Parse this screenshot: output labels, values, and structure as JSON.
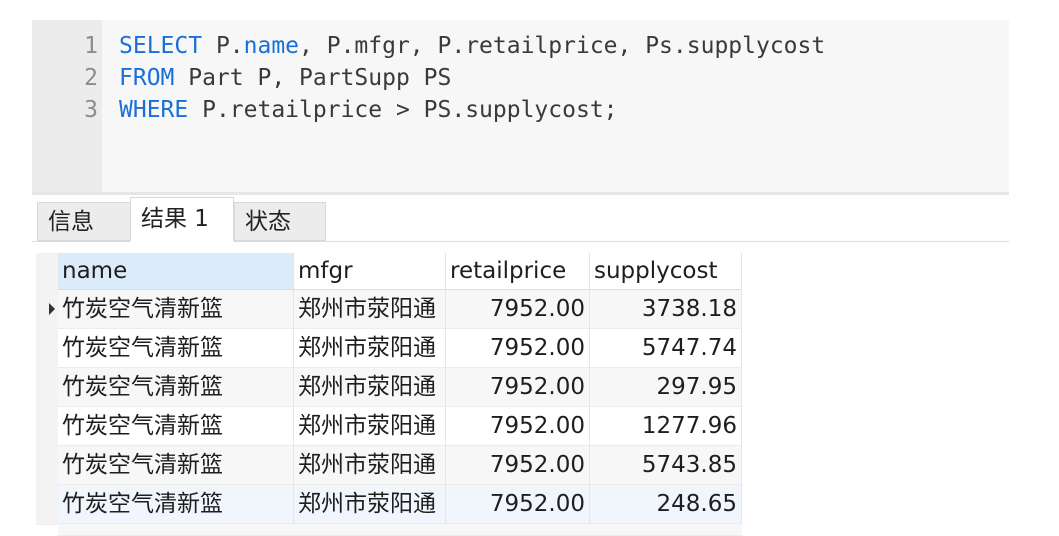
{
  "editor": {
    "lines": [
      {
        "num": "1",
        "parts": [
          {
            "t": "SELECT",
            "k": true
          },
          {
            "t": " P.",
            "k": false
          },
          {
            "t": "name",
            "k": true
          },
          {
            "t": ", P.mfgr, P.retailprice, Ps.supplycost",
            "k": false
          }
        ]
      },
      {
        "num": "2",
        "parts": [
          {
            "t": "FROM",
            "k": true
          },
          {
            "t": " Part P, PartSupp PS",
            "k": false
          }
        ]
      },
      {
        "num": "3",
        "parts": [
          {
            "t": "WHERE",
            "k": true
          },
          {
            "t": " P.retailprice > PS.supplycost;",
            "k": false
          }
        ]
      }
    ]
  },
  "tabs": [
    {
      "label": "信息",
      "active": false
    },
    {
      "label": "结果 1",
      "active": true
    },
    {
      "label": "状态",
      "active": false
    }
  ],
  "grid": {
    "columns": [
      "name",
      "mfgr",
      "retailprice",
      "supplycost"
    ],
    "rows": [
      [
        "竹炭空气清新篮",
        "郑州市荥阳通",
        "7952.00",
        "3738.18"
      ],
      [
        "竹炭空气清新篮",
        "郑州市荥阳通",
        "7952.00",
        "5747.74"
      ],
      [
        "竹炭空气清新篮",
        "郑州市荥阳通",
        "7952.00",
        "297.95"
      ],
      [
        "竹炭空气清新篮",
        "郑州市荥阳通",
        "7952.00",
        "1277.96"
      ],
      [
        "竹炭空气清新篮",
        "郑州市荥阳通",
        "7952.00",
        "5743.85"
      ],
      [
        "竹炭空气清新篮",
        "郑州市荥阳通",
        "7952.00",
        "248.65"
      ]
    ]
  },
  "colors": {
    "keyword": "#1a6fd6",
    "selected_header": "#dcebf9",
    "alt_row": "#f7f7f7",
    "highlight_row": "#f1f6fd"
  }
}
